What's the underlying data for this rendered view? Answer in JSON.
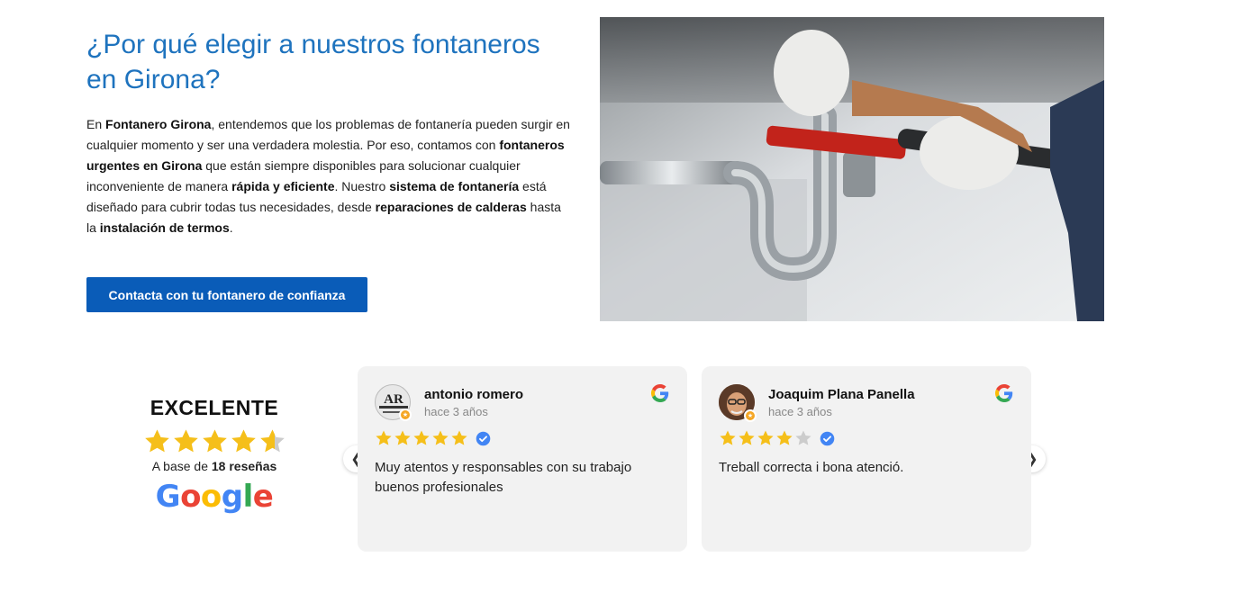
{
  "section": {
    "title": "¿Por qué elegir a nuestros fontaneros en Girona?",
    "intro": {
      "p1": "En ",
      "b1": "Fontanero Girona",
      "p2": ", entendemos que los problemas de fontanería pueden surgir en cualquier momento y ser una verdadera molestia. Por eso, contamos con ",
      "b2": "fontaneros urgentes en Girona",
      "p3": " que están siempre disponibles para solucionar cualquier inconveniente de manera ",
      "b3": "rápida y eficiente",
      "p4": ". Nuestro ",
      "b4": "sistema de fontanería",
      "p5": " está diseñado para cubrir todas tus necesidades, desde ",
      "b5": "reparaciones de calderas",
      "p6": " hasta la ",
      "b6": "instalación de termos",
      "p7": "."
    },
    "cta_label": "Contacta con tu fontanero de confianza"
  },
  "summary": {
    "label": "EXCELENTE",
    "rating": 4.6,
    "based_prefix": "A base de ",
    "based_count": "18 reseñas",
    "brand": "Google"
  },
  "reviews": [
    {
      "name": "antonio romero",
      "time": "hace 3 años",
      "stars": 5,
      "text": "Muy atentos y responsables con su trabajo buenos profesionales",
      "avatar_text": "AR"
    },
    {
      "name": "Joaquim Plana Panella",
      "time": "hace 3 años",
      "stars": 4,
      "text": "Treball correcta i bona atenció."
    }
  ],
  "colors": {
    "title": "#1e73be",
    "button": "#0a5cb8",
    "star": "#f5bf1a",
    "star_empty": "#cccccc",
    "verified": "#4285f4"
  },
  "icons": [
    "google-g-icon",
    "verified-badge-icon",
    "chevron-left-icon",
    "chevron-right-icon",
    "star-icon"
  ]
}
